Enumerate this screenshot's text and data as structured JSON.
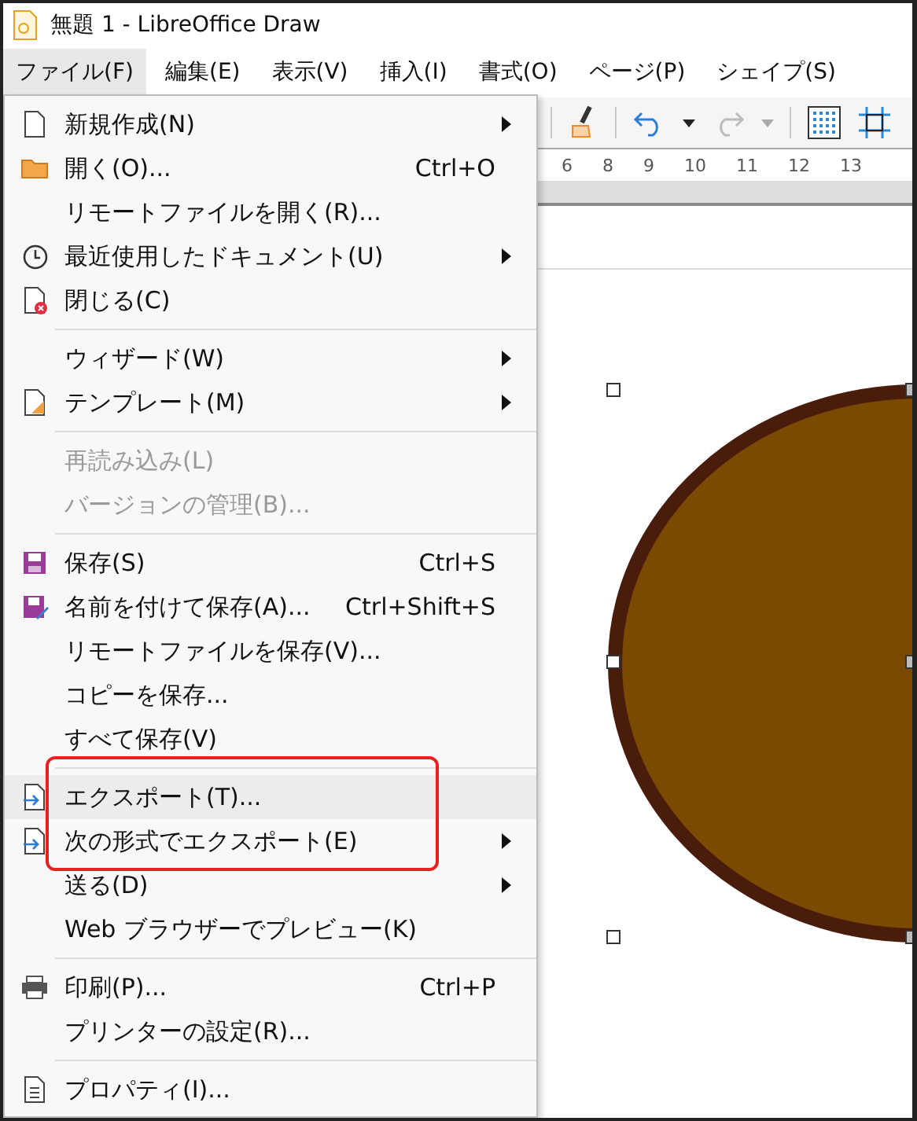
{
  "window": {
    "title": "無題 1 - LibreOffice Draw"
  },
  "menubar": [
    {
      "label": "ファイル(F)",
      "selected": true
    },
    {
      "label": "編集(E)",
      "selected": false
    },
    {
      "label": "表示(V)",
      "selected": false
    },
    {
      "label": "挿入(I)",
      "selected": false
    },
    {
      "label": "書式(O)",
      "selected": false
    },
    {
      "label": "ページ(P)",
      "selected": false
    },
    {
      "label": "シェイプ(S)",
      "selected": false
    }
  ],
  "ruler": [
    "6",
    "8",
    "9",
    "10",
    "11",
    "12",
    "13"
  ],
  "menu": [
    {
      "kind": "new",
      "label": "新規作成(N)",
      "submenu": true,
      "disabled": false,
      "highlighted": false
    },
    {
      "kind": "open",
      "label": "開く(O)...",
      "shortcut": "Ctrl+O",
      "submenu": false,
      "disabled": false,
      "highlighted": false
    },
    {
      "kind": "item",
      "label": "リモートファイルを開く(R)...",
      "submenu": false,
      "disabled": false,
      "highlighted": false
    },
    {
      "kind": "recent",
      "label": "最近使用したドキュメント(U)",
      "submenu": true,
      "disabled": false,
      "highlighted": false
    },
    {
      "kind": "close",
      "label": "閉じる(C)",
      "submenu": false,
      "disabled": false,
      "highlighted": false
    },
    {
      "kind": "separator"
    },
    {
      "kind": "item",
      "label": "ウィザード(W)",
      "submenu": true,
      "disabled": false,
      "highlighted": false
    },
    {
      "kind": "template",
      "label": "テンプレート(M)",
      "submenu": true,
      "disabled": false,
      "highlighted": false
    },
    {
      "kind": "separator"
    },
    {
      "kind": "item",
      "label": "再読み込み(L)",
      "submenu": false,
      "disabled": true,
      "highlighted": false
    },
    {
      "kind": "item",
      "label": "バージョンの管理(B)...",
      "submenu": false,
      "disabled": true,
      "highlighted": false
    },
    {
      "kind": "separator"
    },
    {
      "kind": "save",
      "label": "保存(S)",
      "shortcut": "Ctrl+S",
      "submenu": false,
      "disabled": false,
      "highlighted": false
    },
    {
      "kind": "saveas",
      "label": "名前を付けて保存(A)...",
      "shortcut": "Ctrl+Shift+S",
      "submenu": false,
      "disabled": false,
      "highlighted": false
    },
    {
      "kind": "item",
      "label": "リモートファイルを保存(V)...",
      "submenu": false,
      "disabled": false,
      "highlighted": false
    },
    {
      "kind": "item",
      "label": "コピーを保存...",
      "submenu": false,
      "disabled": false,
      "highlighted": false
    },
    {
      "kind": "item",
      "label": "すべて保存(V)",
      "submenu": false,
      "disabled": false,
      "highlighted": false
    },
    {
      "kind": "separator"
    },
    {
      "kind": "export",
      "label": "エクスポート(T)...",
      "submenu": false,
      "disabled": false,
      "highlighted": true
    },
    {
      "kind": "export",
      "label": "次の形式でエクスポート(E)",
      "submenu": true,
      "disabled": false,
      "highlighted": false
    },
    {
      "kind": "item",
      "label": "送る(D)",
      "submenu": true,
      "disabled": false,
      "highlighted": false
    },
    {
      "kind": "item",
      "label": "Web ブラウザーでプレビュー(K)",
      "submenu": false,
      "disabled": false,
      "highlighted": false
    },
    {
      "kind": "separator"
    },
    {
      "kind": "print",
      "label": "印刷(P)...",
      "shortcut": "Ctrl+P",
      "submenu": false,
      "disabled": false,
      "highlighted": false
    },
    {
      "kind": "item",
      "label": "プリンターの設定(R)...",
      "submenu": false,
      "disabled": false,
      "highlighted": false
    },
    {
      "kind": "separator"
    },
    {
      "kind": "properties",
      "label": "プロパティ(I)...",
      "submenu": false,
      "disabled": false,
      "highlighted": false
    }
  ]
}
